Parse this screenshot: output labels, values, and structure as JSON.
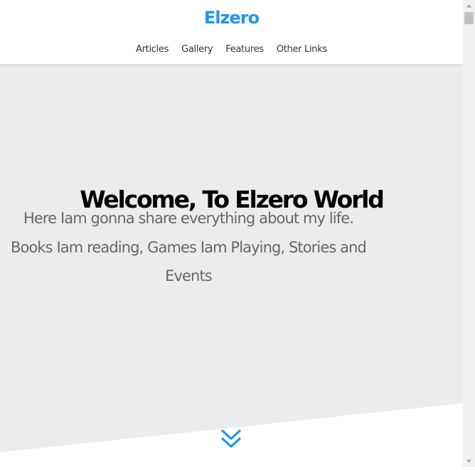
{
  "header": {
    "logo": "Elzero",
    "nav": [
      {
        "label": "Articles"
      },
      {
        "label": "Gallery"
      },
      {
        "label": "Features"
      },
      {
        "label": "Other Links"
      }
    ]
  },
  "landing": {
    "heading": "Welcome, To Elzero World",
    "intro": "Here Iam gonna share everything about my life. Books Iam reading, Games Iam Playing, Stories and Events"
  },
  "icons": {
    "scroll_down": "angles-down-icon"
  },
  "colors": {
    "brand": "#2196f3",
    "landing_bg": "#ececec",
    "text_dark": "#000000",
    "text_muted": "#666666"
  }
}
